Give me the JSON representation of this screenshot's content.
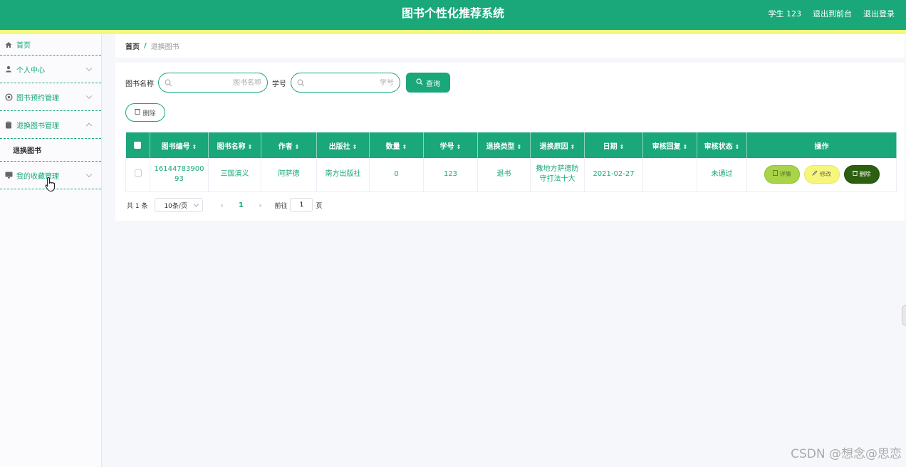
{
  "header": {
    "title": "图书个性化推荐系统",
    "user_label": "学生 123",
    "goto_front": "退出到前台",
    "logout": "退出登录"
  },
  "sidebar": {
    "items": [
      {
        "label": "首页",
        "icon": "home-icon"
      },
      {
        "label": "个人中心",
        "icon": "user-icon"
      },
      {
        "label": "图书预约管理",
        "icon": "gear-icon"
      },
      {
        "label": "退换图书管理",
        "icon": "clipboard-icon",
        "expanded": true,
        "children": [
          {
            "label": "退换图书"
          }
        ]
      },
      {
        "label": "我的收藏管理",
        "icon": "monitor-icon"
      }
    ]
  },
  "breadcrumb": {
    "home": "首页",
    "sep": "/",
    "current": "退换图书"
  },
  "search": {
    "book_name_label": "图书名称",
    "book_name_placeholder": "图书名称",
    "student_id_label": "学号",
    "student_id_placeholder": "学号",
    "query_label": "查询"
  },
  "toolbar": {
    "delete_label": "删除"
  },
  "table": {
    "columns": [
      "图书编号",
      "图书名称",
      "作者",
      "出版社",
      "数量",
      "学号",
      "退换类型",
      "退换原因",
      "日期",
      "审核回复",
      "审核状态",
      "操作"
    ],
    "rows": [
      {
        "book_id": "1614478390093",
        "book_name": "三国演义",
        "author": "阿萨德",
        "publisher": "南方出版社",
        "quantity": "0",
        "student_id": "123",
        "return_type": "退书",
        "reason": "撒地方萨德防守打法十大",
        "date": "2021-02-27",
        "reply": "",
        "status": "未通过"
      }
    ],
    "actions": {
      "detail": "详情",
      "edit": "修改",
      "delete": "删除"
    }
  },
  "pagination": {
    "total": "共 1 条",
    "page_size": "10条/页",
    "current_page": "1",
    "goto_label": "前往",
    "goto_value": "1",
    "page_suffix": "页"
  },
  "watermark": "CSDN @想念@思恋",
  "colors": {
    "primary": "#1aa77a",
    "accent_bar": "#f3f979",
    "detail_btn": "#a9d447",
    "edit_btn": "#f6f77a",
    "delete_btn": "#2c5f10"
  }
}
